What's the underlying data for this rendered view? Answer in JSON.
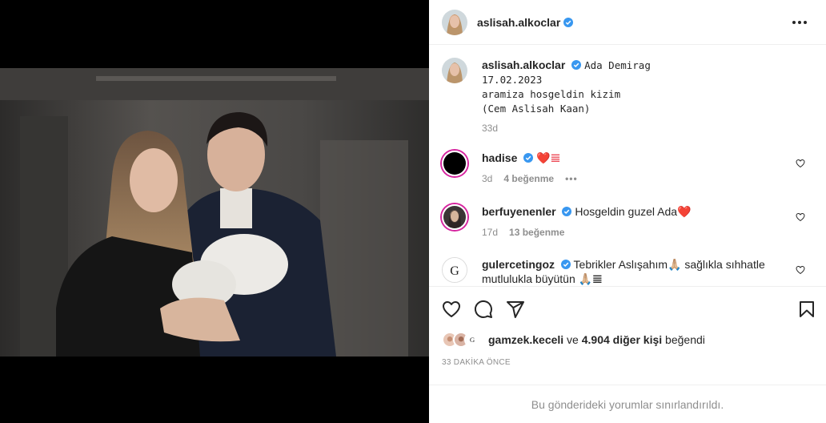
{
  "post": {
    "author": "aslisah.alkoclar",
    "time_ago": "33 DAKİKA ÖNCE",
    "restricted_notice": "Bu gönderideki yorumlar sınırlandırıldı."
  },
  "caption": {
    "username": "aslisah.alkoclar",
    "tag": "Ada Demirag",
    "line1": "17.02.2023",
    "line2": "aramiza hosgeldin kizim",
    "line3": "(Cem Aslisah Kaan)",
    "time": "33d"
  },
  "comments": [
    {
      "username": "hadise",
      "text": "❤️𝌆",
      "time": "3d",
      "likes": "4 beğenme"
    },
    {
      "username": "berfuyenenler",
      "text": "Hosgeldin guzel Ada❤️",
      "time": "17d",
      "likes": "13 beğenme"
    },
    {
      "username": "gulercetingoz",
      "text": "Tebrikler Aslışahım🙏🏼 sağlıkla sıhhatle mutlulukla büyütün 🙏🏼𝌆"
    }
  ],
  "likes": {
    "first_user": "gamzek.keceli",
    "connector": " ve ",
    "others": "4.904 diğer kişi",
    "suffix": " beğendi"
  },
  "colors": {
    "verified": "#3897f0",
    "like_red": "#ed4956",
    "muted": "#8e8e8e",
    "story_ring": "#d6249f"
  },
  "icons": [
    "verified-icon",
    "more-options-icon",
    "heart-icon",
    "comment-icon",
    "share-icon",
    "bookmark-icon"
  ]
}
